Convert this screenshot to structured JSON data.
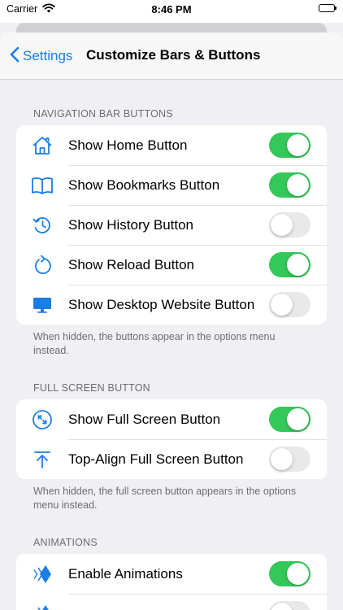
{
  "status_bar": {
    "carrier": "Carrier",
    "time": "8:46 PM"
  },
  "nav": {
    "back_label": "Settings",
    "title": "Customize Bars & Buttons"
  },
  "sections": [
    {
      "header": "NAVIGATION BAR BUTTONS",
      "rows": [
        {
          "label": "Show Home Button",
          "icon": "home-icon",
          "on": true
        },
        {
          "label": "Show Bookmarks Button",
          "icon": "book-icon",
          "on": true
        },
        {
          "label": "Show History Button",
          "icon": "history-icon",
          "on": false
        },
        {
          "label": "Show Reload Button",
          "icon": "reload-icon",
          "on": true
        },
        {
          "label": "Show Desktop Website Button",
          "icon": "desktop-icon",
          "on": false
        }
      ],
      "footer": "When hidden, the buttons appear in the options menu instead."
    },
    {
      "header": "FULL SCREEN BUTTON",
      "rows": [
        {
          "label": "Show Full Screen Button",
          "icon": "fullscreen-icon",
          "on": true
        },
        {
          "label": "Top-Align Full Screen Button",
          "icon": "arrow-up-to-line-icon",
          "on": false
        }
      ],
      "footer": "When hidden, the full screen button appears in the options menu instead."
    },
    {
      "header": "ANIMATIONS",
      "rows": [
        {
          "label": "Enable Animations",
          "icon": "animation-icon",
          "on": true
        },
        {
          "label": "",
          "icon": "animation-icon",
          "on": false
        }
      ]
    }
  ],
  "colors": {
    "accent": "#1a7ee6",
    "toggle_on": "#34c759",
    "toggle_off": "#e9e9ea"
  }
}
